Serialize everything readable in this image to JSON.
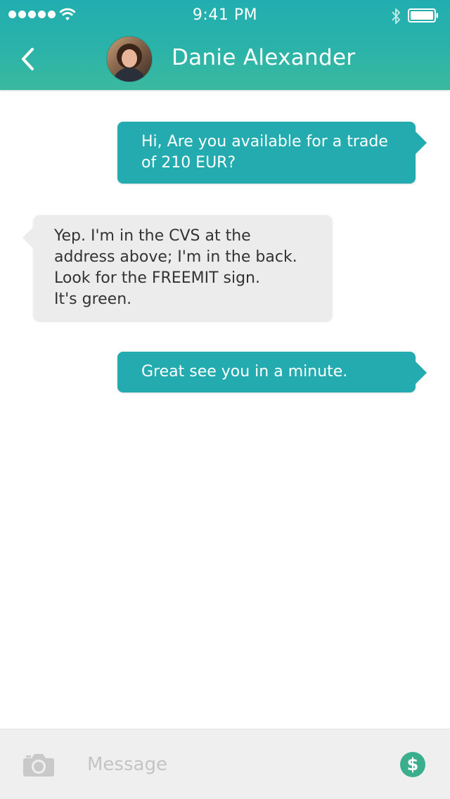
{
  "status_bar": {
    "time": "9:41 PM",
    "signal_icon": "signal-dots-icon",
    "wifi_icon": "wifi-icon",
    "bluetooth_icon": "bluetooth-icon",
    "battery_icon": "battery-icon"
  },
  "header": {
    "back_icon": "chevron-left-icon",
    "contact_name": "Danie Alexander",
    "colors": {
      "start": "#22aeb0",
      "end": "#3bb99f"
    }
  },
  "messages": [
    {
      "direction": "sent",
      "text": "Hi, Are you available for a trade\nof 210 EUR?"
    },
    {
      "direction": "received",
      "text": "Yep. I'm in the CVS at the\naddress above; I'm in the back.\nLook for the FREEMIT sign.\nIt's green."
    },
    {
      "direction": "sent",
      "text": "Great see you in a minute."
    }
  ],
  "composer": {
    "camera_icon": "camera-icon",
    "placeholder": "Message",
    "value": "",
    "send_money_icon": "dollar-icon",
    "send_money_symbol": "$"
  },
  "colors": {
    "sent_bubble": "#24abaf",
    "received_bubble": "#ececec",
    "money_button": "#3aae8d"
  }
}
